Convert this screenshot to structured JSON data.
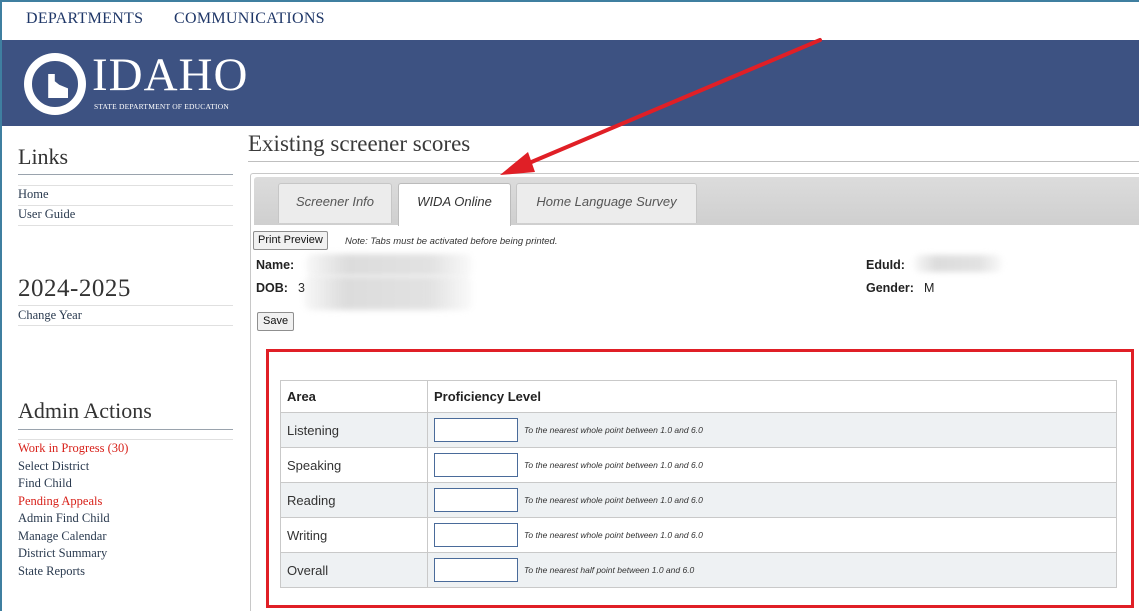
{
  "topnav": {
    "departments": "DEPARTMENTS",
    "communications": "COMMUNICATIONS"
  },
  "brand": {
    "name": "IDAHO",
    "subtitle": "STATE DEPARTMENT OF EDUCATION"
  },
  "sidebar": {
    "links_heading": "Links",
    "links": [
      "Home",
      "User Guide"
    ],
    "year": "2024-2025",
    "change_year": "Change Year",
    "admin_heading": "Admin Actions",
    "admin_items": [
      {
        "label": "Work in Progress (30)",
        "color": "#d8221b"
      },
      {
        "label": "Select District",
        "color": "#2a3a4f"
      },
      {
        "label": "Find Child",
        "color": "#2a3a4f"
      },
      {
        "label": "Pending Appeals",
        "color": "#d8221b"
      },
      {
        "label": "Admin Find Child",
        "color": "#2a3a4f"
      },
      {
        "label": "Manage Calendar",
        "color": "#2a3a4f"
      },
      {
        "label": "District Summary",
        "color": "#2a3a4f"
      },
      {
        "label": "State Reports",
        "color": "#2a3a4f"
      }
    ]
  },
  "main": {
    "title": "Existing screener scores",
    "tabs": [
      "Screener Info",
      "WIDA Online",
      "Home Language Survey"
    ],
    "active_tab": "WIDA Online",
    "print_button": "Print Preview",
    "print_note": "Note: Tabs must be activated before being printed.",
    "student": {
      "name_label": "Name:",
      "dob_label": "DOB:",
      "dob_visible": "3",
      "eduid_label": "EduId:",
      "gender_label": "Gender:",
      "gender_value": "M"
    },
    "save_button": "Save",
    "table": {
      "headers": [
        "Area",
        "Proficiency Level"
      ],
      "rows": [
        {
          "area": "Listening",
          "value": "",
          "hint": "To the nearest whole point between 1.0 and 6.0"
        },
        {
          "area": "Speaking",
          "value": "",
          "hint": "To the nearest whole point between 1.0 and 6.0"
        },
        {
          "area": "Reading",
          "value": "",
          "hint": "To the nearest whole point between 1.0 and 6.0"
        },
        {
          "area": "Writing",
          "value": "",
          "hint": "To the nearest whole point between 1.0 and 6.0"
        },
        {
          "area": "Overall",
          "value": "",
          "hint": "To the nearest half point between 1.0 and 6.0"
        }
      ]
    }
  },
  "colors": {
    "banner": "#3d5282",
    "annotation": "#e01f26",
    "alert_link": "#d8221b",
    "nav_text": "#1f3768"
  }
}
